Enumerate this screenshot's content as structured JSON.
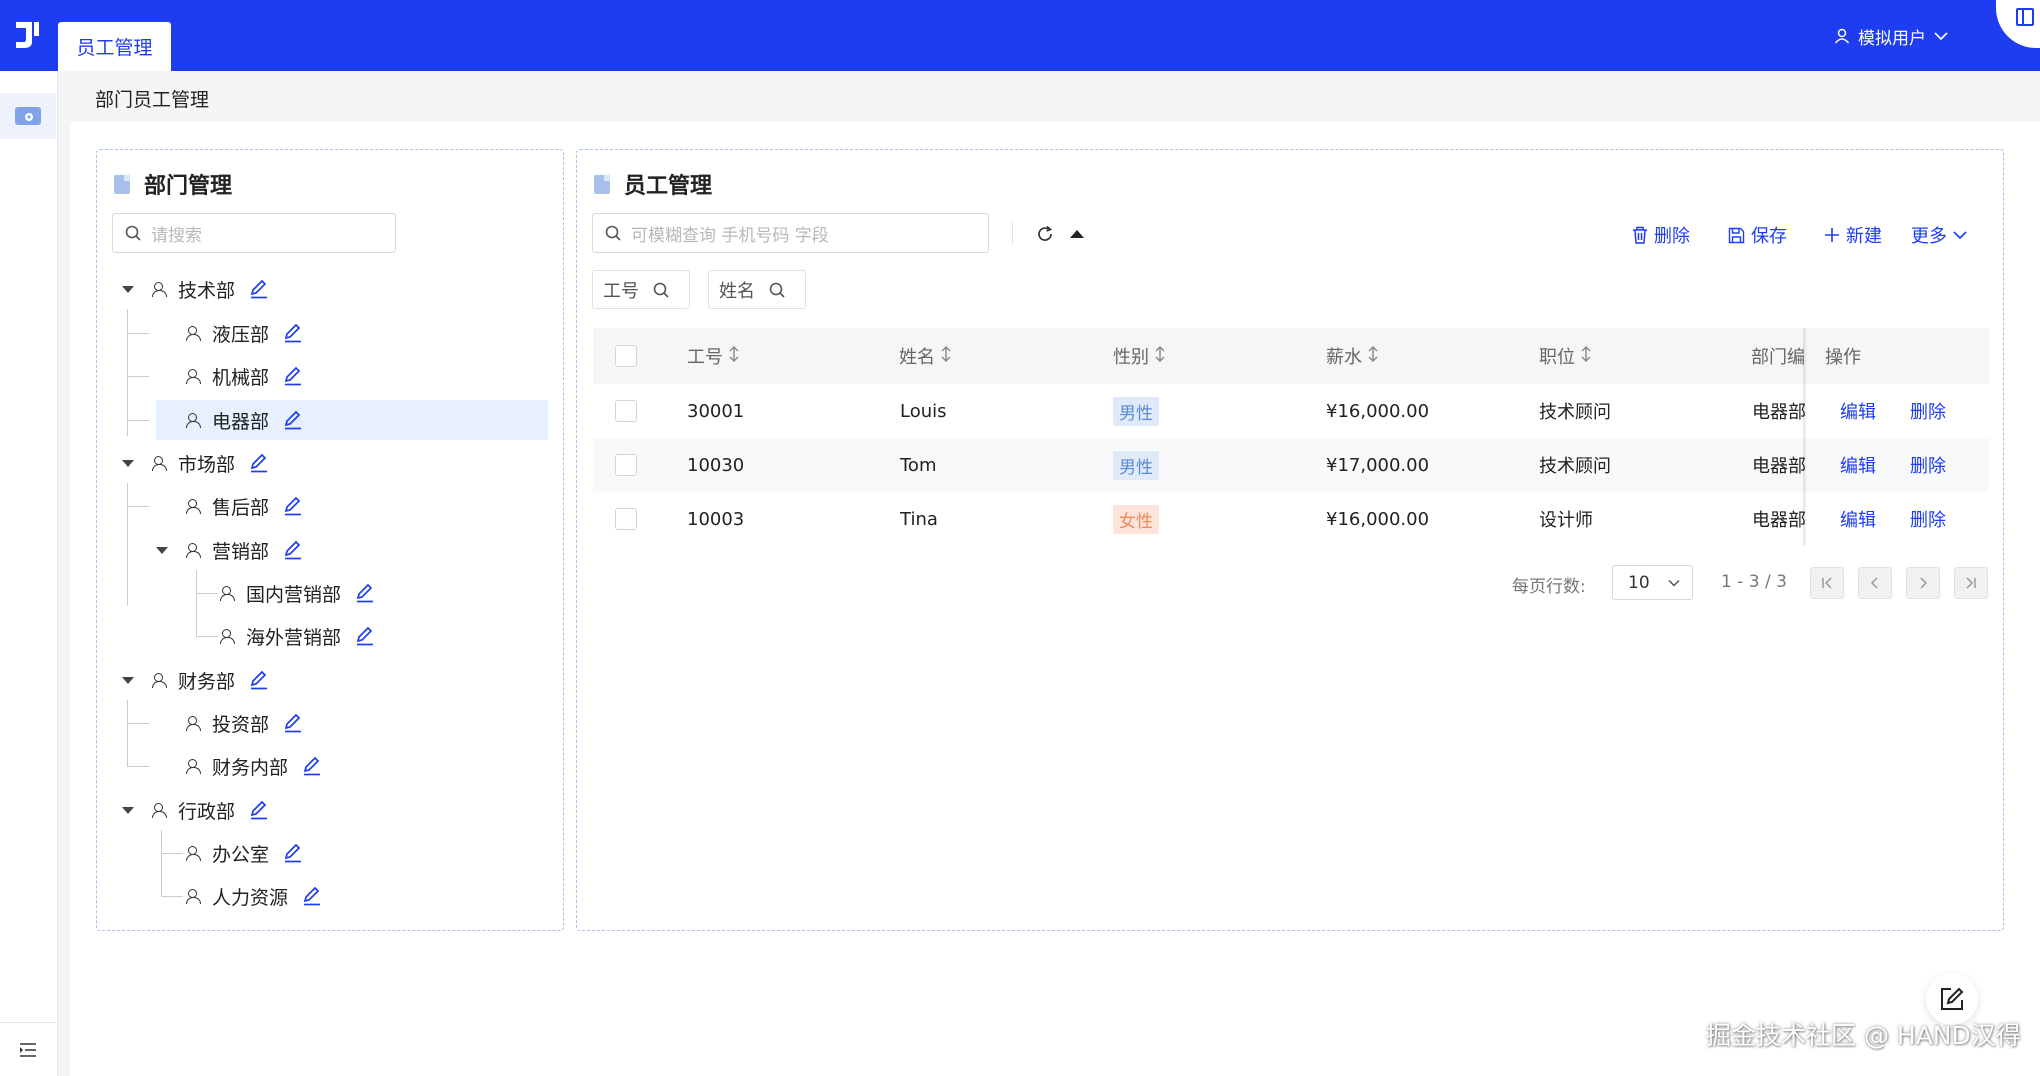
{
  "app": {
    "active_tab": "员工管理",
    "user_name": "模拟用户",
    "breadcrumb": "部门员工管理",
    "watermark": "掘金技术社区 @ HAND汉得",
    "accent_color": "#1e3cf0"
  },
  "dept_panel": {
    "title": "部门管理",
    "search_placeholder": "请搜索",
    "tree": [
      {
        "label": "技术部",
        "level": 0,
        "expanded": true
      },
      {
        "label": "液压部",
        "level": 1
      },
      {
        "label": "机械部",
        "level": 1
      },
      {
        "label": "电器部",
        "level": 1,
        "selected": true
      },
      {
        "label": "市场部",
        "level": 0,
        "expanded": true
      },
      {
        "label": "售后部",
        "level": 1
      },
      {
        "label": "营销部",
        "level": 1,
        "expanded": true
      },
      {
        "label": "国内营销部",
        "level": 2
      },
      {
        "label": "海外营销部",
        "level": 2
      },
      {
        "label": "财务部",
        "level": 0,
        "expanded": true
      },
      {
        "label": "投资部",
        "level": 1
      },
      {
        "label": "财务内部",
        "level": 1
      },
      {
        "label": "行政部",
        "level": 0,
        "expanded": true
      },
      {
        "label": "办公室",
        "level": 1
      },
      {
        "label": "人力资源",
        "level": 1
      }
    ]
  },
  "emp_panel": {
    "title": "员工管理",
    "search_placeholder": "可模糊查询 手机号码 字段",
    "toolbar": {
      "delete": "删除",
      "save": "保存",
      "new": "新建",
      "more": "更多"
    },
    "filters": [
      "工号",
      "姓名"
    ],
    "columns": [
      "工号",
      "姓名",
      "性别",
      "薪水",
      "职位",
      "部门编",
      "操作"
    ],
    "rows": [
      {
        "id": "30001",
        "name": "Louis",
        "gender": "男性",
        "salary": "¥16,000.00",
        "position": "技术顾问",
        "dept": "电器部"
      },
      {
        "id": "10030",
        "name": "Tom",
        "gender": "男性",
        "salary": "¥17,000.00",
        "position": "技术顾问",
        "dept": "电器部"
      },
      {
        "id": "10003",
        "name": "Tina",
        "gender": "女性",
        "salary": "¥16,000.00",
        "position": "设计师",
        "dept": "电器部"
      }
    ],
    "row_actions": {
      "edit": "编辑",
      "delete": "删除"
    },
    "pager": {
      "rows_label": "每页行数:",
      "page_size": "10",
      "range": "1 - 3 / 3"
    }
  }
}
